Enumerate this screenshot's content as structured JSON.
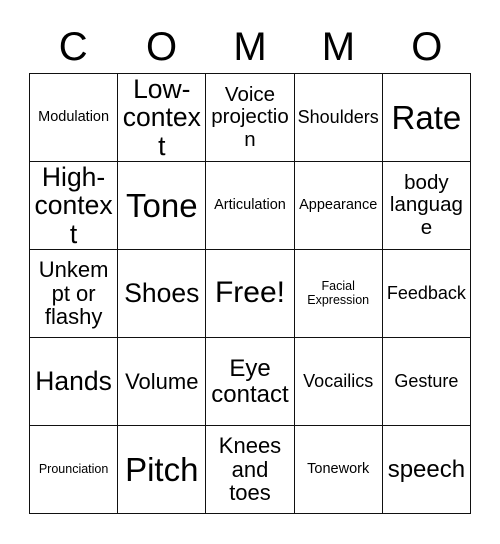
{
  "card": {
    "title_letters": [
      "C",
      "O",
      "M",
      "M",
      "O"
    ],
    "grid_size": "5x5",
    "free_space_label": "Free!",
    "colors": {
      "background": "#ffffff",
      "grid_line": "#111111",
      "text": "#000000"
    },
    "rows": [
      [
        {
          "text": "Modulation",
          "size": "fs-s"
        },
        {
          "text": "Low-context",
          "size": "fs-2xl"
        },
        {
          "text": "Voice projection",
          "size": "fs-ml"
        },
        {
          "text": "Shoulders",
          "size": "fs-m"
        },
        {
          "text": "Rate",
          "size": "fs-4xl"
        }
      ],
      [
        {
          "text": "High-context",
          "size": "fs-2xl"
        },
        {
          "text": "Tone",
          "size": "fs-4xl"
        },
        {
          "text": "Articulation",
          "size": "fs-s"
        },
        {
          "text": "Appearance",
          "size": "fs-s"
        },
        {
          "text": "body language",
          "size": "fs-ml"
        }
      ],
      [
        {
          "text": "Unkempt or flashy",
          "size": "fs-l"
        },
        {
          "text": "Shoes",
          "size": "fs-2xl"
        },
        {
          "text": "Free!",
          "size": "fs-3xl"
        },
        {
          "text": "Facial Expression",
          "size": "fs-xs"
        },
        {
          "text": "Feedback",
          "size": "fs-m"
        }
      ],
      [
        {
          "text": "Hands",
          "size": "fs-2xl"
        },
        {
          "text": "Volume",
          "size": "fs-l"
        },
        {
          "text": "Eye contact",
          "size": "fs-xl"
        },
        {
          "text": "Vocailics",
          "size": "fs-m"
        },
        {
          "text": "Gesture",
          "size": "fs-m"
        }
      ],
      [
        {
          "text": "Prounciation",
          "size": "fs-xs"
        },
        {
          "text": "Pitch",
          "size": "fs-4xl"
        },
        {
          "text": "Knees and toes",
          "size": "fs-l"
        },
        {
          "text": "Tonework",
          "size": "fs-s"
        },
        {
          "text": "speech",
          "size": "fs-xl"
        }
      ]
    ]
  }
}
